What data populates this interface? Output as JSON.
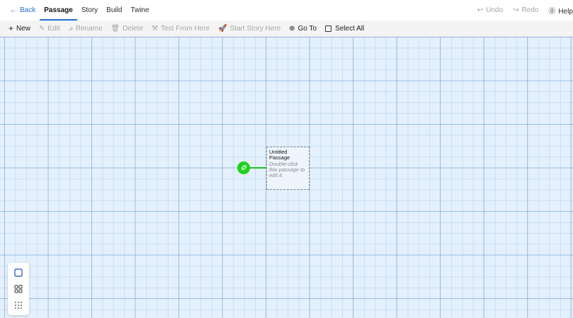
{
  "nav": {
    "back": "Back",
    "tabs": [
      {
        "label": "Passage",
        "active": true
      },
      {
        "label": "Story"
      },
      {
        "label": "Build"
      },
      {
        "label": "Twine"
      }
    ],
    "undo": "Undo",
    "redo": "Redo",
    "help": "Help"
  },
  "toolbar": {
    "new": "New",
    "edit": "Edit",
    "rename": "Rename",
    "delete": "Delete",
    "test_from_here": "Test From Here",
    "start_story_here": "Start Story Here",
    "go_to": "Go To",
    "select_all": "Select All"
  },
  "passage": {
    "title": "Untitled Passage",
    "excerpt": "Double-click this passage to edit it."
  },
  "colors": {
    "accent": "#1f6fd1",
    "start": "#1fd11f",
    "canvas": "#e4f0fc"
  },
  "icons": {
    "start": "rocket-icon",
    "zoom": [
      "zoom-large-icon",
      "zoom-medium-icon",
      "zoom-small-icon"
    ]
  }
}
